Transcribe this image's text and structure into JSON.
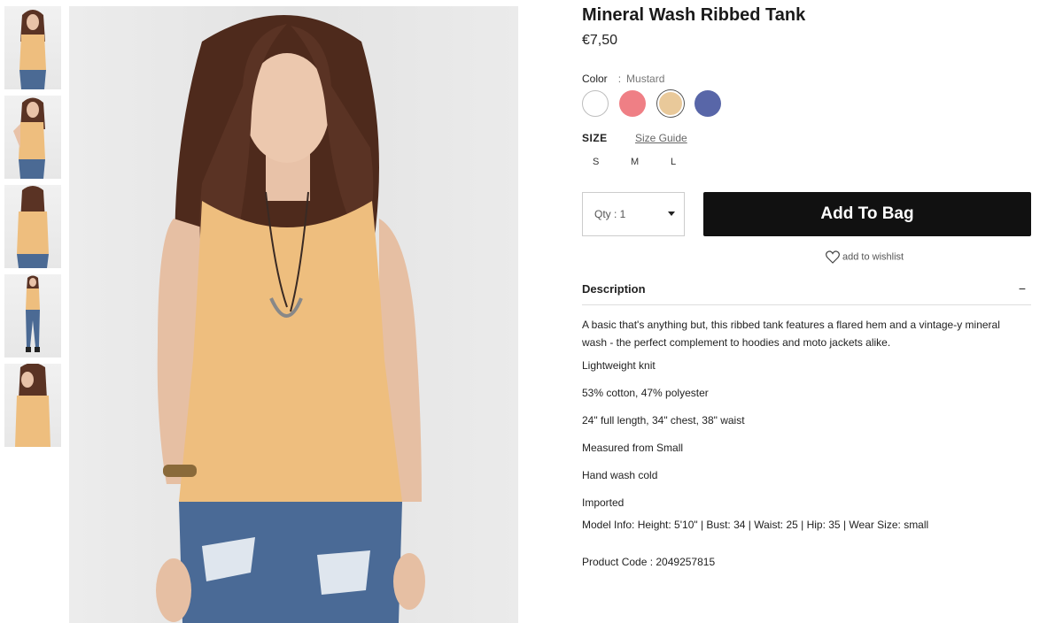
{
  "product": {
    "title": "Mineral Wash Ribbed Tank",
    "price": "€7,50"
  },
  "color": {
    "label": "Color",
    "separator": ":",
    "selected": "Mustard",
    "swatches": [
      "#ffffff",
      "#ef7f85",
      "#e9c99a",
      "#5866a8"
    ]
  },
  "size": {
    "label": "SIZE",
    "guide_link": "Size Guide",
    "options": [
      "S",
      "M",
      "L"
    ]
  },
  "purchase": {
    "qty_label": "Qty : 1",
    "add_to_bag": "Add To Bag",
    "wishlist": "add to wishlist"
  },
  "description": {
    "title": "Description",
    "toggle": "−",
    "paragraph": "A basic that's anything but, this ribbed tank features a flared hem and a vintage-y mineral wash - the perfect complement to hoodies and moto jackets alike.",
    "details": [
      "Lightweight knit",
      "53% cotton, 47% polyester",
      "24\" full length, 34\" chest, 38\" waist",
      "Measured from Small",
      "Hand wash cold",
      "Imported",
      "Model Info: Height: 5'10\" | Bust: 34 | Waist: 25 | Hip: 35 | Wear Size: small"
    ],
    "product_code": "Product Code : 2049257815"
  }
}
